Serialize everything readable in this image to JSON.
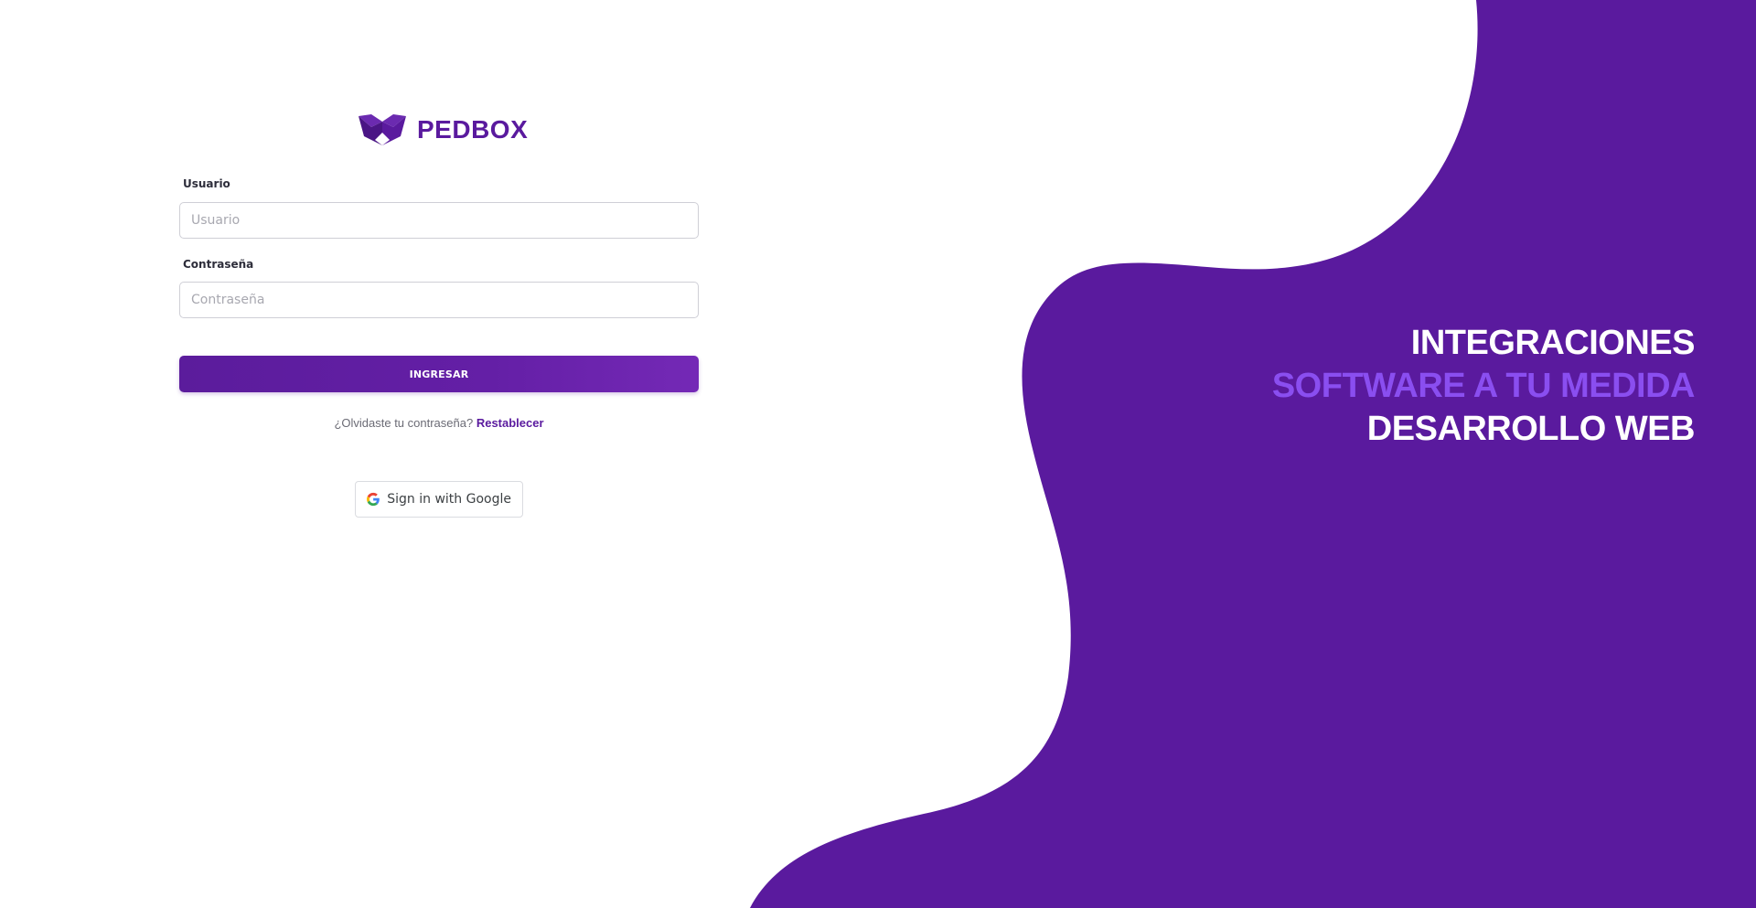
{
  "brand": {
    "name": "PEDBOX",
    "color": "#5a1a9e",
    "accent_color": "#8a4ef0",
    "background_color": "#5a1a9e"
  },
  "form": {
    "username_label": "Usuario",
    "username_placeholder": "Usuario",
    "username_value": "",
    "password_label": "Contraseña",
    "password_placeholder": "Contraseña",
    "password_value": "",
    "submit_label": "INGRESAR",
    "forgot_text": "¿Olvidaste tu contraseña?",
    "reset_link": "Restablecer",
    "google_label": "Sign in with Google",
    "google_icon": "google-g-icon"
  },
  "hero": {
    "line1": "INTEGRACIONES",
    "line2": "SOFTWARE A TU MEDIDA",
    "line3": "DESARROLLO WEB"
  },
  "icons": {
    "logo": "box-logo-icon"
  }
}
